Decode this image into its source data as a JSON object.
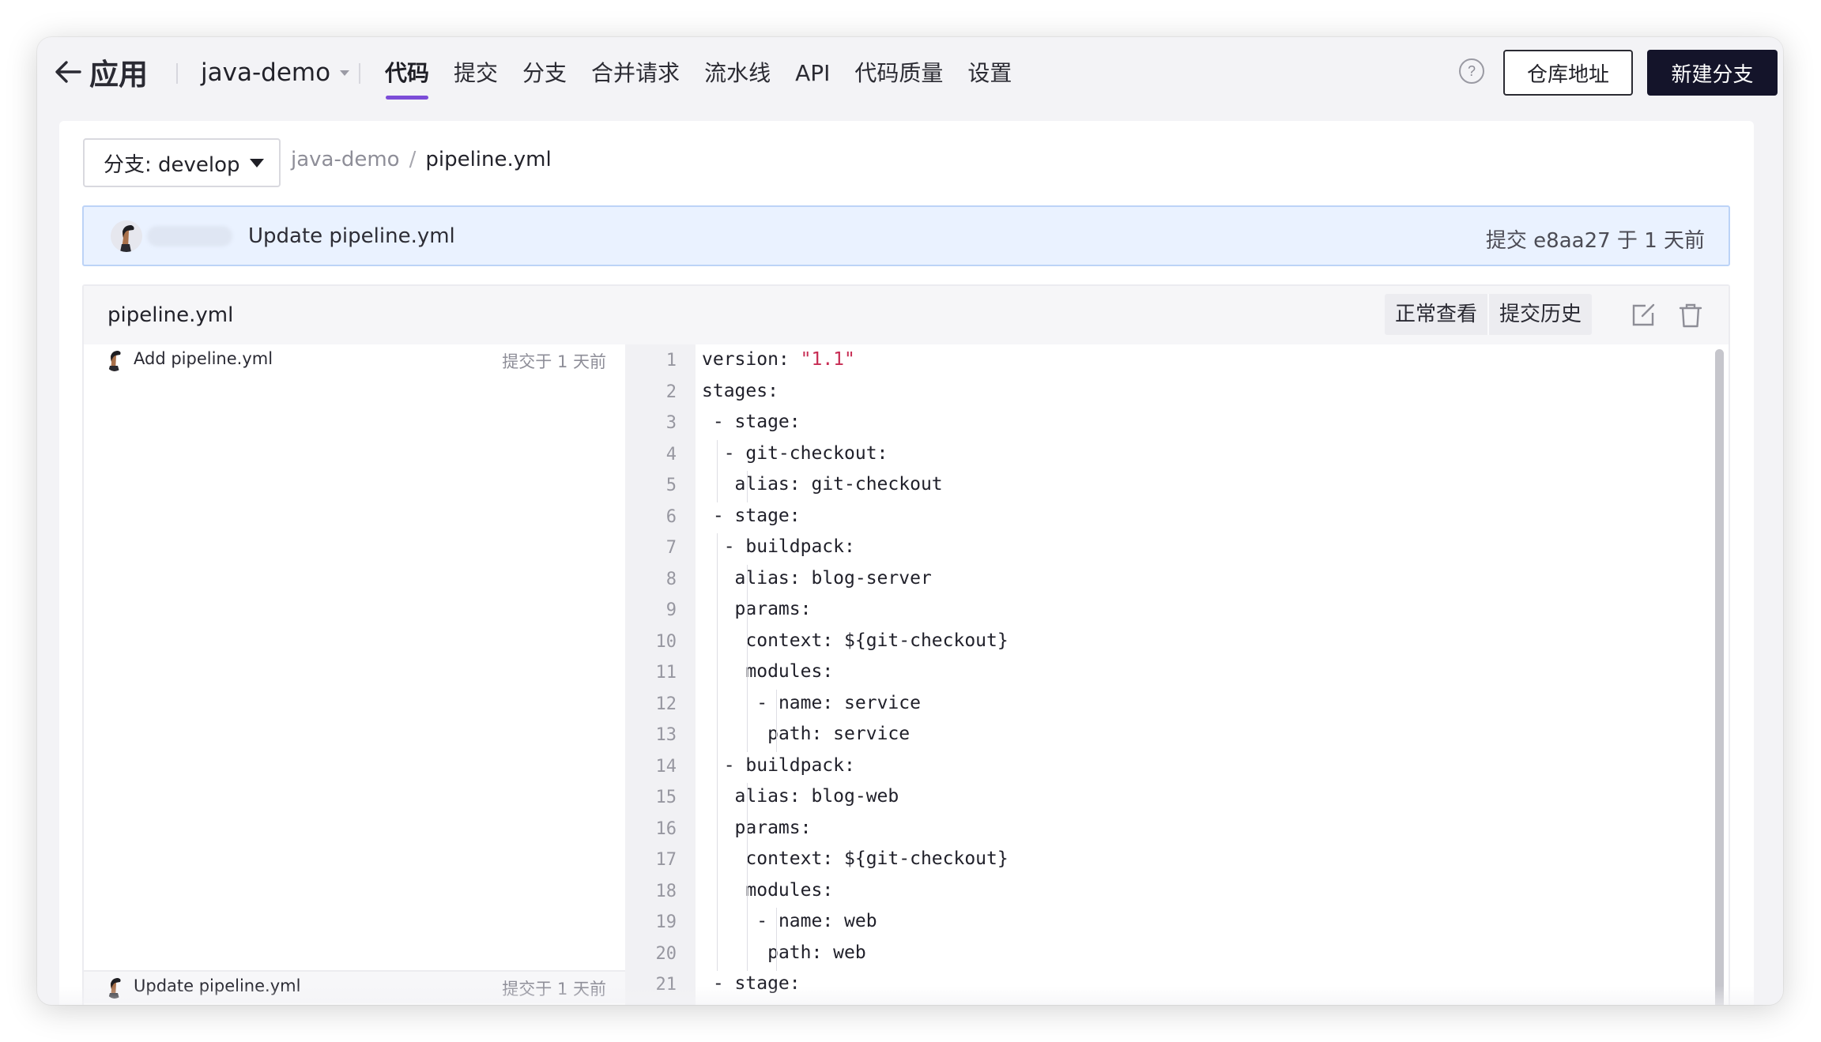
{
  "header": {
    "back_label": "应用",
    "project_name": "java-demo",
    "tabs": [
      {
        "label": "代码",
        "active": true
      },
      {
        "label": "提交",
        "active": false
      },
      {
        "label": "分支",
        "active": false
      },
      {
        "label": "合并请求",
        "active": false
      },
      {
        "label": "流水线",
        "active": false
      },
      {
        "label": "API",
        "active": false
      },
      {
        "label": "代码质量",
        "active": false
      },
      {
        "label": "设置",
        "active": false
      }
    ],
    "help_glyph": "?",
    "repo_address_label": "仓库地址",
    "new_branch_label": "新建分支"
  },
  "branch_selector": {
    "label": "分支: develop"
  },
  "breadcrumb": {
    "repo": "java-demo",
    "separator": "/",
    "file": "pipeline.yml"
  },
  "commit_bar": {
    "message": "Update pipeline.yml",
    "meta": "提交 e8aa27 于 1 天前"
  },
  "file": {
    "name": "pipeline.yml",
    "mode_normal": "正常查看",
    "mode_history": "提交历史"
  },
  "blame": [
    {
      "message": "Add pipeline.yml",
      "time": "提交于 1 天前"
    },
    {
      "message": "Update pipeline.yml",
      "time": "提交于 1 天前"
    }
  ],
  "code_lines": [
    {
      "n": "1",
      "key": "version: ",
      "str": "\"1.1\""
    },
    {
      "n": "2",
      "key": "stages:"
    },
    {
      "n": "3",
      "key": "- stage:"
    },
    {
      "n": "4",
      "key": "- git-checkout:"
    },
    {
      "n": "5",
      "key": "alias: git-checkout"
    },
    {
      "n": "6",
      "key": "- stage:"
    },
    {
      "n": "7",
      "key": "- buildpack:"
    },
    {
      "n": "8",
      "key": "alias: blog-server"
    },
    {
      "n": "9",
      "key": "params:"
    },
    {
      "n": "10",
      "key": "context: ${git-checkout}"
    },
    {
      "n": "11",
      "key": "modules:"
    },
    {
      "n": "12",
      "key": "- name: service"
    },
    {
      "n": "13",
      "key": "path: service"
    },
    {
      "n": "14",
      "key": "- buildpack:"
    },
    {
      "n": "15",
      "key": "alias: blog-web"
    },
    {
      "n": "16",
      "key": "params:"
    },
    {
      "n": "17",
      "key": "context: ${git-checkout}"
    },
    {
      "n": "18",
      "key": "modules:"
    },
    {
      "n": "19",
      "key": "- name: web"
    },
    {
      "n": "20",
      "key": "path: web"
    },
    {
      "n": "21",
      "key": "- stage:"
    }
  ],
  "colors": {
    "accent": "#7c4dd8",
    "primary_button": "#14142a",
    "commit_bar_bg": "#eaf2ff",
    "string": "#c72c53"
  }
}
